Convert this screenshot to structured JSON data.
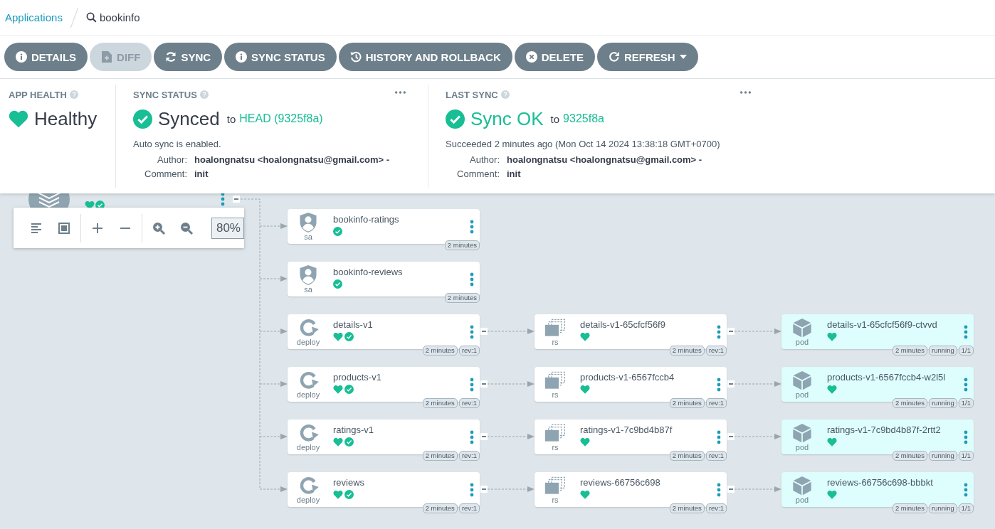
{
  "breadcrumb": {
    "link": "Applications",
    "current": "bookinfo"
  },
  "actions": [
    {
      "label": "DETAILS",
      "kind": "details",
      "disabled": false
    },
    {
      "label": "DIFF",
      "kind": "diff",
      "disabled": true
    },
    {
      "label": "SYNC",
      "kind": "sync",
      "disabled": false
    },
    {
      "label": "SYNC STATUS",
      "kind": "status",
      "disabled": false
    },
    {
      "label": "HISTORY AND ROLLBACK",
      "kind": "history",
      "disabled": false
    },
    {
      "label": "DELETE",
      "kind": "delete",
      "disabled": false
    },
    {
      "label": "REFRESH",
      "kind": "refresh",
      "disabled": false,
      "dropdown": true
    }
  ],
  "status_panel": {
    "app_health": {
      "title": "APP HEALTH",
      "status": "Healthy"
    },
    "sync_status": {
      "title": "SYNC STATUS",
      "status": "Synced",
      "to": "to",
      "revision": "HEAD (9325f8a)",
      "message": "Auto sync is enabled.",
      "fields": [
        {
          "label": "Author:",
          "value": "hoalongnatsu <hoalongnatsu@gmail.com> -"
        },
        {
          "label": "Comment:",
          "value": "init"
        }
      ]
    },
    "last_sync": {
      "title": "LAST SYNC",
      "status": "Sync OK",
      "to": "to",
      "revision": "9325f8a",
      "message": "Succeeded 2 minutes ago (Mon Oct 14 2024 13:38:18 GMT+0700)",
      "fields": [
        {
          "label": "Author:",
          "value": "hoalongnatsu <hoalongnatsu@gmail.com> -"
        },
        {
          "label": "Comment:",
          "value": "init"
        }
      ]
    }
  },
  "zoom_controls": {
    "zoom": "80%"
  },
  "graph": {
    "app_node": {
      "healthy": true,
      "synced": true
    },
    "rows": [
      {
        "nodes": [
          {
            "name": "bookinfo-ratings",
            "type": "sa",
            "healthy": false,
            "synced": true,
            "badges": [
              "2 minutes"
            ]
          }
        ]
      },
      {
        "nodes": [
          {
            "name": "bookinfo-reviews",
            "type": "sa",
            "healthy": false,
            "synced": true,
            "badges": [
              "2 minutes"
            ]
          }
        ]
      },
      {
        "nodes": [
          {
            "name": "details-v1",
            "type": "deploy",
            "healthy": true,
            "synced": true,
            "badges": [
              "2 minutes",
              "rev:1"
            ]
          },
          {
            "name": "details-v1-65cfcf56f9",
            "type": "rs",
            "healthy": true,
            "synced": false,
            "badges": [
              "2 minutes",
              "rev:1"
            ]
          },
          {
            "name": "details-v1-65cfcf56f9-ctvvd",
            "type": "pod",
            "healthy": true,
            "synced": false,
            "badges": [
              "2 minutes",
              "running",
              "1/1"
            ]
          }
        ]
      },
      {
        "nodes": [
          {
            "name": "products-v1",
            "type": "deploy",
            "healthy": true,
            "synced": true,
            "badges": [
              "2 minutes",
              "rev:1"
            ]
          },
          {
            "name": "products-v1-6567fccb4",
            "type": "rs",
            "healthy": true,
            "synced": false,
            "badges": [
              "2 minutes",
              "rev:1"
            ]
          },
          {
            "name": "products-v1-6567fccb4-w2l5l",
            "type": "pod",
            "healthy": true,
            "synced": false,
            "badges": [
              "2 minutes",
              "running",
              "1/1"
            ]
          }
        ]
      },
      {
        "nodes": [
          {
            "name": "ratings-v1",
            "type": "deploy",
            "healthy": true,
            "synced": true,
            "badges": [
              "2 minutes",
              "rev:1"
            ]
          },
          {
            "name": "ratings-v1-7c9bd4b87f",
            "type": "rs",
            "healthy": true,
            "synced": false,
            "badges": [
              "2 minutes",
              "rev:1"
            ]
          },
          {
            "name": "ratings-v1-7c9bd4b87f-2rtt2",
            "type": "pod",
            "healthy": true,
            "synced": false,
            "badges": [
              "2 minutes",
              "running",
              "1/1"
            ]
          }
        ]
      },
      {
        "nodes": [
          {
            "name": "reviews",
            "type": "deploy",
            "healthy": true,
            "synced": true,
            "badges": [
              "2 minutes",
              "rev:1"
            ]
          },
          {
            "name": "reviews-66756c698",
            "type": "rs",
            "healthy": true,
            "synced": false,
            "badges": [
              "2 minutes",
              "rev:1"
            ]
          },
          {
            "name": "reviews-66756c698-bbbkt",
            "type": "pod",
            "healthy": true,
            "synced": false,
            "badges": [
              "2 minutes",
              "running",
              "1/1"
            ]
          }
        ]
      }
    ]
  }
}
